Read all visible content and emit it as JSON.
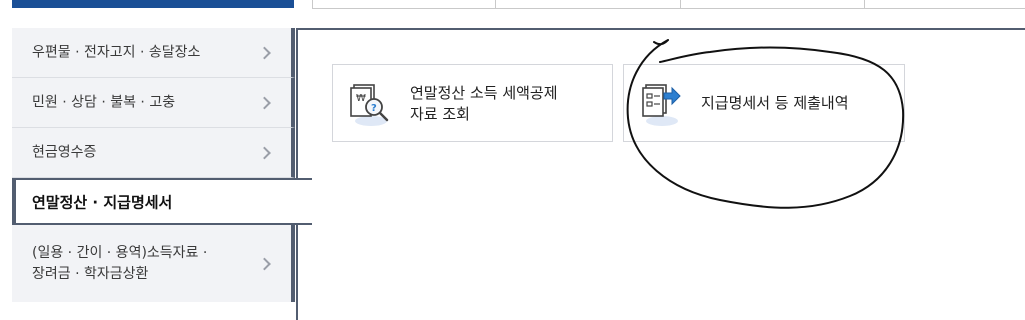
{
  "sidebar": {
    "items": [
      {
        "label": "우편물 · 전자고지 · 송달장소"
      },
      {
        "label": "민원 · 상담 · 불복 · 고충"
      },
      {
        "label": "현금영수증"
      },
      {
        "label": "연말정산 · 지급명세서"
      },
      {
        "label_line1": "(일용 · 간이 · 용역)소득자료 ·",
        "label_line2": "장려금 · 학자금상환"
      }
    ]
  },
  "cards": [
    {
      "label_line1": "연말정산 소득 세액공제",
      "label_line2": "자료 조회",
      "icon": "document-search-icon"
    },
    {
      "label": "지급명세서 등 제출내역",
      "icon": "document-submit-icon"
    }
  ],
  "colors": {
    "brand_blue": "#1a4f96",
    "border_dark": "#525d70",
    "sidebar_bg": "#f2f3f6",
    "icon_accent": "#2d7fd0"
  }
}
